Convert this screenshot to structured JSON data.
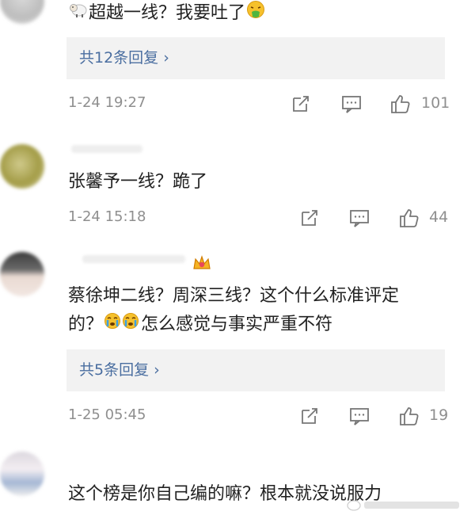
{
  "comments": [
    {
      "text": "超越一线？我要吐了",
      "replies": "共12条回复",
      "time": "1-24 19:27",
      "likes": "101"
    },
    {
      "text": "张馨予一线？跪了",
      "time": "1-24 15:18",
      "likes": "44"
    },
    {
      "text_line1": "蔡徐坤二线？周深三线？这个什么标准评定",
      "text_line2_a": "的？",
      "text_line2_b": "怎么感觉与事实严重不符",
      "replies": "共5条回复",
      "time": "1-25 05:45",
      "likes": "19"
    },
    {
      "text": "这个榜是你自己编的嘛？根本就没说服力"
    }
  ],
  "reply_chevron": "›",
  "icons": [
    "share-icon",
    "comment-icon",
    "like-icon",
    "sheep-emoji-icon",
    "vomit-emoji-icon",
    "crown-badge-icon",
    "crying-emoji-icon"
  ],
  "colors": {
    "link": "#4a6ea0",
    "meta": "#8f8f8f",
    "reply_bg": "#f2f2f2"
  }
}
